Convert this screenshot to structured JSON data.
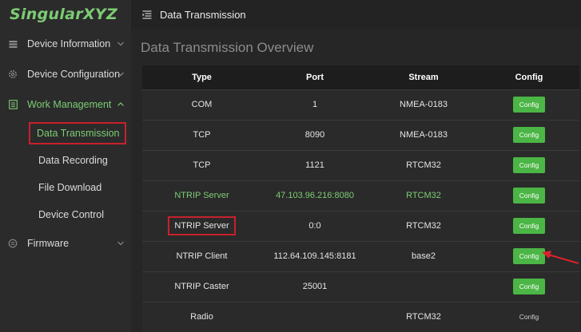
{
  "brand": {
    "logo_text": "SingularXYZ"
  },
  "header": {
    "title": "Data Transmission"
  },
  "sidebar": {
    "items": [
      {
        "label": "Device Information",
        "icon": "device-info-icon"
      },
      {
        "label": "Device Configuration",
        "icon": "gear-icon"
      },
      {
        "label": "Work Management",
        "icon": "work-management-icon",
        "children": [
          {
            "label": "Data Transmission"
          },
          {
            "label": "Data Recording"
          },
          {
            "label": "File Download"
          },
          {
            "label": "Device Control"
          }
        ]
      },
      {
        "label": "Firmware",
        "icon": "firmware-icon"
      }
    ]
  },
  "main": {
    "title": "Data Transmission Overview",
    "table": {
      "headers": [
        "Type",
        "Port",
        "Stream",
        "Config"
      ],
      "rows": [
        {
          "type": "COM",
          "port": "1",
          "stream": "NMEA-0183",
          "config": "Config"
        },
        {
          "type": "TCP",
          "port": "8090",
          "stream": "NMEA-0183",
          "config": "Config"
        },
        {
          "type": "TCP",
          "port": "1121",
          "stream": "RTCM32",
          "config": "Config"
        },
        {
          "type": "NTRIP Server",
          "port": "47.103.96.216:8080",
          "stream": "RTCM32",
          "config": "Config"
        },
        {
          "type": "NTRIP Server",
          "port": "0:0",
          "stream": "RTCM32",
          "config": "Config"
        },
        {
          "type": "NTRIP Client",
          "port": "112.64.109.145:8181",
          "stream": "base2",
          "config": "Config"
        },
        {
          "type": "NTRIP Caster",
          "port": "25001",
          "stream": "",
          "config": "Config"
        },
        {
          "type": "Radio",
          "port": "",
          "stream": "RTCM32",
          "config": "Config"
        }
      ]
    }
  },
  "colors": {
    "accent": "#7ccc74",
    "button": "#4bb545",
    "highlight": "#c8212b"
  }
}
